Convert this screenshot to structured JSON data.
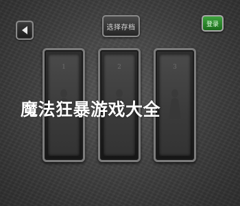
{
  "header": {
    "title": "选择存档",
    "login_label": "登录",
    "back_icon": "left-arrow-icon"
  },
  "slots": [
    {
      "number": "1"
    },
    {
      "number": "2"
    },
    {
      "number": "3"
    }
  ],
  "overlay": {
    "text": "魔法狂暴游戏大全"
  },
  "colors": {
    "background": "#3e3e3e",
    "login_button": "#2a8a2a",
    "frame_border": "#8a8a8a"
  }
}
